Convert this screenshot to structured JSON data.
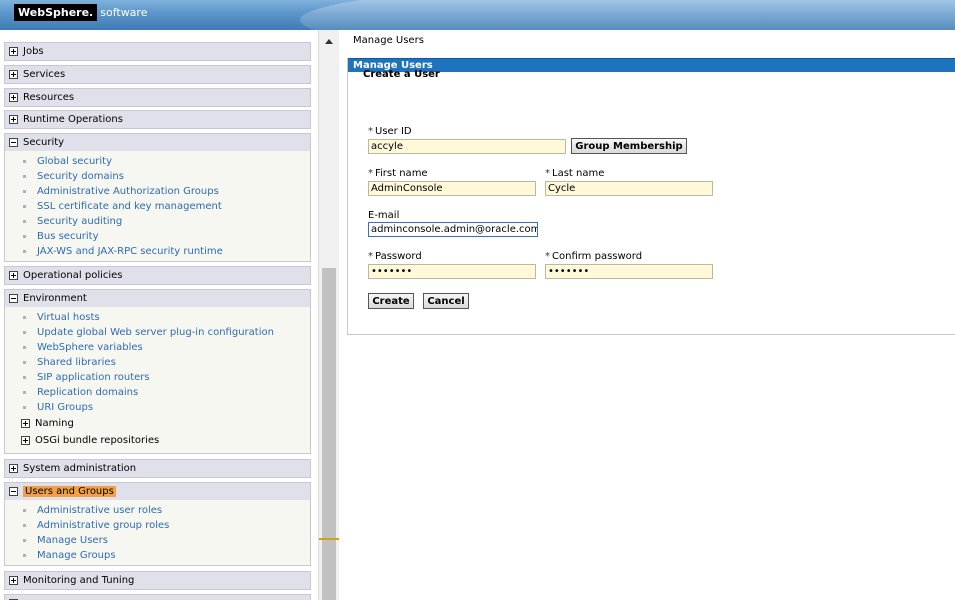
{
  "banner": {
    "brand": "WebSphere.",
    "product": "software"
  },
  "nav": {
    "top_partial": "...",
    "sections": [
      {
        "label": "Jobs",
        "expanded": false
      },
      {
        "label": "Services",
        "expanded": false
      },
      {
        "label": "Resources",
        "expanded": false
      },
      {
        "label": "Runtime Operations",
        "expanded": false
      },
      {
        "label": "Security",
        "expanded": true,
        "items": [
          "Global security",
          "Security domains",
          "Administrative Authorization Groups",
          "SSL certificate and key management",
          "Security auditing",
          "Bus security",
          "JAX-WS and JAX-RPC security runtime"
        ]
      },
      {
        "label": "Operational policies",
        "expanded": false
      },
      {
        "label": "Environment",
        "expanded": true,
        "items": [
          "Virtual hosts",
          "Update global Web server plug-in configuration",
          "WebSphere variables",
          "Shared libraries",
          "SIP application routers",
          "Replication domains",
          "URI Groups"
        ],
        "folders": [
          "Naming",
          "OSGi bundle repositories"
        ]
      },
      {
        "label": "System administration",
        "expanded": false
      },
      {
        "label": "Users and Groups",
        "expanded": true,
        "items": [
          "Administrative user roles",
          "Administrative group roles",
          "Manage Users",
          "Manage Groups"
        ]
      },
      {
        "label": "Monitoring and Tuning",
        "expanded": false
      }
    ]
  },
  "content": {
    "breadcrumb": "Manage Users",
    "panel_title": "Manage Users",
    "form_title": "Create a User",
    "fields": {
      "user_id": {
        "label": "User ID",
        "value": "accyle",
        "required": true
      },
      "first_name": {
        "label": "First name",
        "value": "AdminConsole",
        "required": true
      },
      "last_name": {
        "label": "Last name",
        "value": "Cycle",
        "required": true
      },
      "email": {
        "label": "E-mail",
        "value": "adminconsole.admin@oracle.com",
        "required": false
      },
      "password": {
        "label": "Password",
        "value": "•••••••",
        "required": true
      },
      "confirm_password": {
        "label": "Confirm password",
        "value": "•••••••",
        "required": true
      }
    },
    "required_mark": "*",
    "buttons": {
      "group_membership": "Group Membership",
      "create": "Create",
      "cancel": "Cancel"
    }
  },
  "colors": {
    "panel_header": "#1e73be",
    "link": "#2e6bb0",
    "selected": "#f2a043",
    "field_bg": "#fff8d9"
  }
}
